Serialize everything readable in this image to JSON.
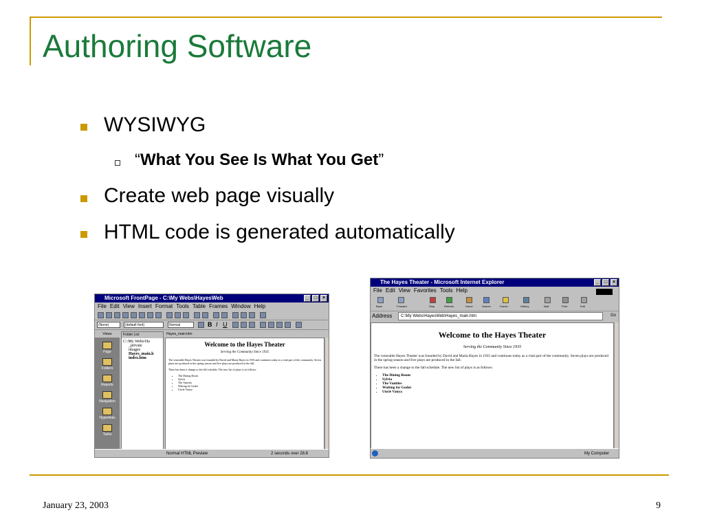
{
  "slide": {
    "title": "Authoring Software",
    "bullets": [
      {
        "text": "WYSIWYG"
      },
      {
        "text": "Create web page visually"
      },
      {
        "text": "HTML code is generated automatically"
      }
    ],
    "sub_bullet": {
      "open_quote": "“",
      "text": "What You See Is What You Get",
      "close_quote": "”"
    },
    "footer": {
      "date": "January 23, 2003",
      "page": "9"
    },
    "accent_color": "#cc9900",
    "title_color": "#1a7a3a"
  },
  "frontpage": {
    "title": "Microsoft FrontPage - C:\\My Webs\\HayesWeb",
    "menu": [
      "File",
      "Edit",
      "View",
      "Insert",
      "Format",
      "Tools",
      "Table",
      "Frames",
      "Window",
      "Help"
    ],
    "style_select": "(None)",
    "font_select": "(default font)",
    "size_select": "Normal",
    "views_header": "Views",
    "views": [
      "Page",
      "Folders",
      "Reports",
      "Navigation",
      "Hyperlinks",
      "Tasks"
    ],
    "folder_header": "Folder List",
    "folders": [
      "C:\\My Webs\\Ha",
      "_private",
      "images",
      "Hayes_main.h",
      "index.htm"
    ],
    "doc_tab": "Hayes_main.htm",
    "status_left": "Normal  HTML  Preview",
    "status_right": "2 seconds over 28.8"
  },
  "ie": {
    "title": "The Hayes Theater - Microsoft Internet Explorer",
    "menu": [
      "File",
      "Edit",
      "View",
      "Favorites",
      "Tools",
      "Help"
    ],
    "toolbar": [
      "Back",
      "Forward",
      "Stop",
      "Refresh",
      "Home",
      "Search",
      "Favori...",
      "History",
      "Mail",
      "Print",
      "Edit"
    ],
    "address_label": "Address",
    "address": "C:\\My Webs\\HayesWeb\\Hayes_main.htm",
    "go": "Go",
    "status_right": "My Computer"
  },
  "page": {
    "heading": "Welcome to the Hayes Theater",
    "subheading": "Serving the Community Since 1935",
    "para1": "The venerable Hayes Theater was founded by David and Maria Hayes in 1935 and continues today as a vital part of the community. Seven plays are produced in the spring season and five plays are produced in the fall.",
    "para2": "There has been a change to the fall schedule. The new list of plays is as follows:",
    "plays": [
      "The Dining Room",
      "Sylvia",
      "The Vanities",
      "Waiting for Godot",
      "Uncle Vanya"
    ]
  }
}
